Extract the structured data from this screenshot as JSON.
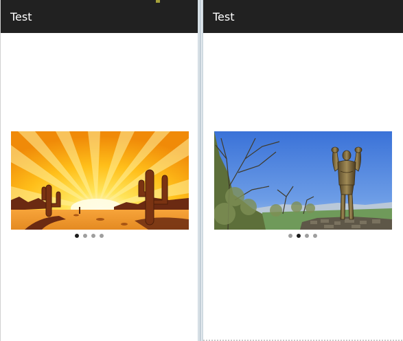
{
  "screens": [
    {
      "app_title": "Test",
      "carousel": {
        "image_icon": "desert-cactus-sunset-image",
        "active_index": 0,
        "page_count": 4
      }
    },
    {
      "app_title": "Test",
      "carousel": {
        "image_icon": "bronze-statue-landscape-image",
        "active_index": 1,
        "page_count": 4
      }
    }
  ],
  "colors": {
    "app_bar": "#212121",
    "title_text": "#ffffff",
    "dot_active": "#1c1c1c",
    "dot_inactive": "#9e9e9e"
  }
}
